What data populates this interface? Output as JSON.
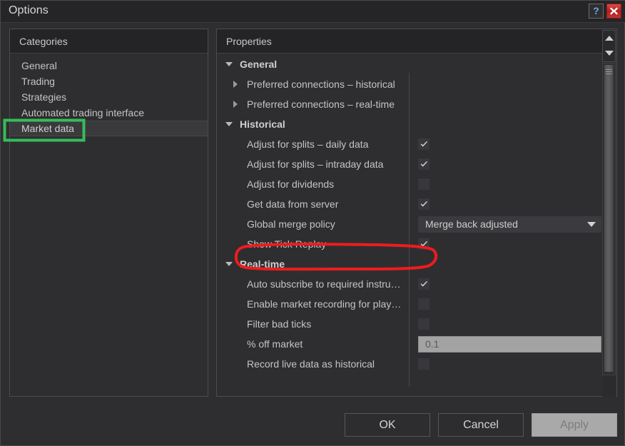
{
  "window": {
    "title": "Options",
    "help_button_label": "?",
    "close_button_label": "close-icon"
  },
  "categories": {
    "header": "Categories",
    "items": [
      {
        "label": "General",
        "selected": false
      },
      {
        "label": "Trading",
        "selected": false
      },
      {
        "label": "Strategies",
        "selected": false
      },
      {
        "label": "Automated trading interface",
        "selected": false
      },
      {
        "label": "Market data",
        "selected": true
      }
    ]
  },
  "properties": {
    "header": "Properties",
    "groups": [
      {
        "label": "General",
        "expanded": true,
        "items": [
          {
            "label": "Preferred connections – historical",
            "type": "subgroup"
          },
          {
            "label": "Preferred connections – real-time",
            "type": "subgroup"
          }
        ]
      },
      {
        "label": "Historical",
        "expanded": true,
        "items": [
          {
            "label": "Adjust for splits – daily data",
            "type": "checkbox",
            "checked": true
          },
          {
            "label": "Adjust for splits – intraday data",
            "type": "checkbox",
            "checked": true
          },
          {
            "label": "Adjust for dividends",
            "type": "checkbox",
            "checked": false
          },
          {
            "label": "Get data from server",
            "type": "checkbox",
            "checked": true
          },
          {
            "label": "Global merge policy",
            "type": "combo",
            "value": "Merge back adjusted"
          },
          {
            "label": "Show Tick Replay",
            "type": "checkbox",
            "checked": true
          }
        ]
      },
      {
        "label": "Real-time",
        "expanded": true,
        "items": [
          {
            "label": "Auto subscribe to required instru…",
            "type": "checkbox",
            "checked": true
          },
          {
            "label": "Enable market recording for play…",
            "type": "checkbox",
            "checked": false
          },
          {
            "label": "Filter bad ticks",
            "type": "checkbox",
            "checked": false
          },
          {
            "label": "% off market",
            "type": "text",
            "value": "0.1"
          },
          {
            "label": "Record live data as historical",
            "type": "checkbox",
            "checked": false
          }
        ]
      }
    ]
  },
  "footer": {
    "ok_label": "OK",
    "cancel_label": "Cancel",
    "apply_label": "Apply"
  },
  "annotations": {
    "green_color": "#35bd5a",
    "red_color": "#ee1c1c",
    "green_target": "Market data",
    "red_target": "Show Tick Replay"
  }
}
